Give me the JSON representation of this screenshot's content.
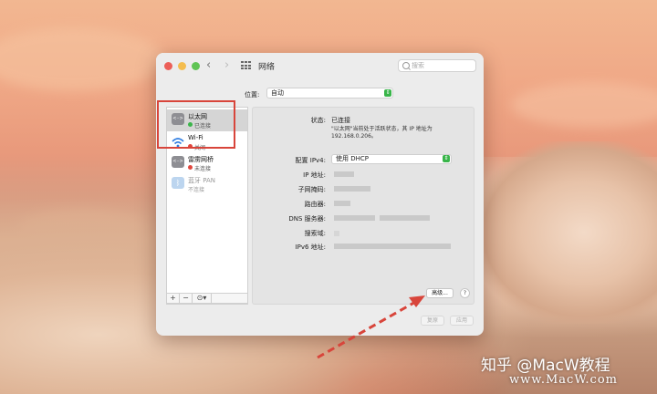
{
  "window": {
    "title": "网络",
    "search_placeholder": "搜索"
  },
  "location": {
    "label": "位置:",
    "value": "自动"
  },
  "sidebar": {
    "items": [
      {
        "name": "以太网",
        "status": "已连接",
        "status_color": "#3bb54a",
        "icon": "ethernet-icon",
        "icon_glyph": "<··>"
      },
      {
        "name": "Wi-Fi",
        "status": "关闭",
        "status_color": "#e0473e",
        "icon": "wifi-icon"
      },
      {
        "name": "雷雳网桥",
        "status": "未连接",
        "status_color": "#e0473e",
        "icon": "thunderbolt-bridge-icon",
        "icon_glyph": "<··>"
      },
      {
        "name": "蓝牙 PAN",
        "status": "不连接",
        "icon": "bluetooth-icon",
        "icon_glyph": "ᛒ"
      }
    ],
    "footer": {
      "add": "+",
      "remove": "−",
      "actions": "⊙▾"
    }
  },
  "detail": {
    "status_label": "状态:",
    "status_value": "已连接",
    "status_description": "\"以太网\"当前处于活跃状态，其 IP 地址为 192.168.0.206。",
    "configure_label": "配置 IPv4:",
    "configure_value": "使用 DHCP",
    "ip_label": "IP 地址:",
    "subnet_label": "子网掩码:",
    "router_label": "路由器:",
    "dns_label": "DNS 服务器:",
    "search_domains_label": "搜索域:",
    "ipv6_label": "IPv6 地址:",
    "advanced_button": "高级...",
    "help_button": "?",
    "revert_button": "复原",
    "apply_button": "应用"
  },
  "watermark": {
    "line1": "知乎 @MacW教程",
    "line2": "www.MacW.com"
  },
  "colors": {
    "highlight": "#d8453b",
    "window_bg": "#ececec"
  }
}
